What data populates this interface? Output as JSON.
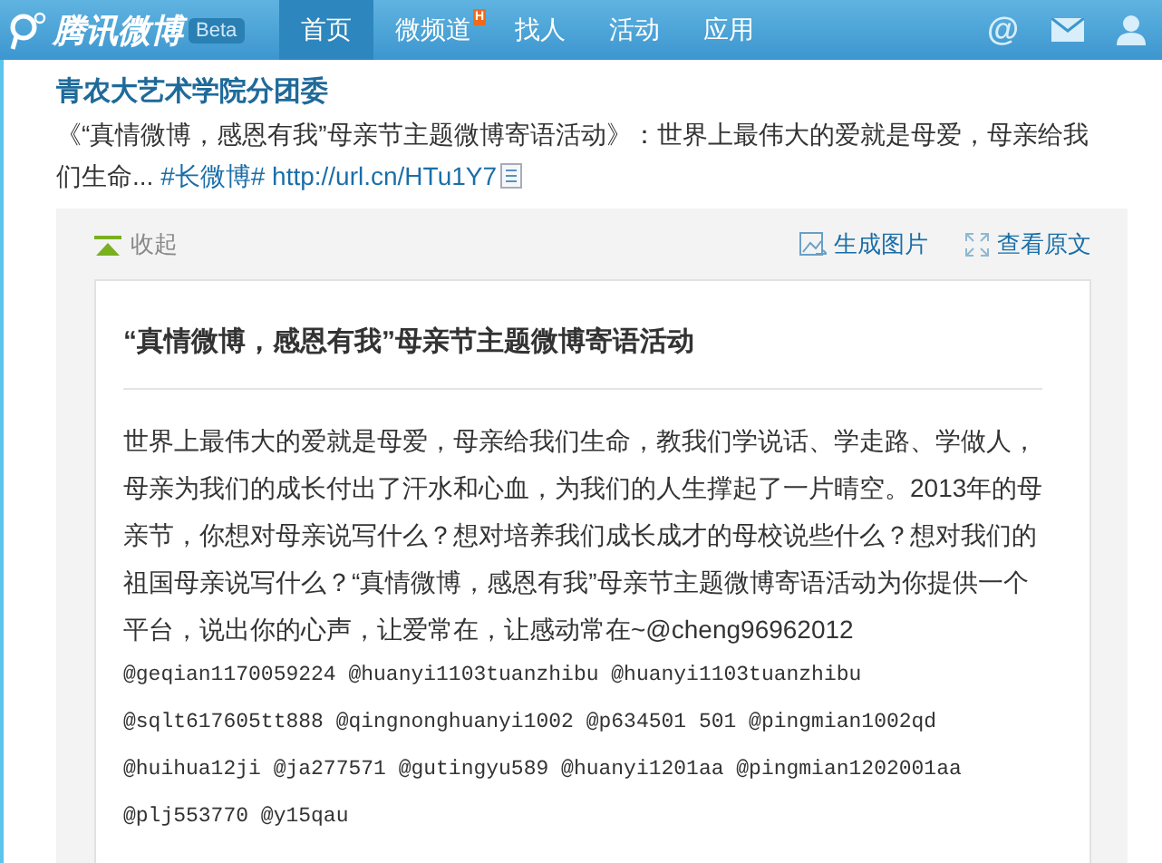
{
  "header": {
    "logo": "腾讯微博",
    "badge": "Beta",
    "tabs": [
      {
        "label": "首页",
        "selected": true
      },
      {
        "label": "微频道",
        "selected": false,
        "badge": "H"
      },
      {
        "label": "找人",
        "selected": false
      },
      {
        "label": "活动",
        "selected": false
      },
      {
        "label": "应用",
        "selected": false
      }
    ],
    "at_symbol": "@"
  },
  "post": {
    "author": "青农大艺术学院分团委",
    "text": "《“真情微博，感恩有我”母亲节主题微博寄语活动》：世界上最伟大的爱就是母爱，母亲给我们生命...",
    "hashtag": "#长微博#",
    "link": "http://url.cn/HTu1Y7"
  },
  "long_post": {
    "collapse": "收起",
    "actions": [
      "生成图片",
      "查看原文"
    ],
    "title": "“真情微博，感恩有我”母亲节主题微博寄语活动",
    "body": "世界上最伟大的爱就是母爱，母亲给我们生命，教我们学说话、学走路、学做人，母亲为我们的成长付出了汗水和心血，为我们的人生撑起了一片晴空。2013年的母亲节，你想对母亲说写什么？想对培养我们成长成才的母校说些什么？想对我们的祖国母亲说写什么？“真情微博，感恩有我”母亲节主题微博寄语活动为你提供一个平台，说出你的心声，让爱常在，让感动常在~@cheng96962012",
    "mention_lines": [
      "@geqian1170059224 @huanyi1103tuanzhibu @huanyi1103tuanzhibu",
      "@sqlt617605tt888 @qingnonghuanyi1002 @p634501 501 @pingmian1002qd",
      "@huihua12ji @ja277571 @gutingyu589 @huanyi1201aa @pingmian1202001aa",
      "@plj553770 @y15qau"
    ]
  }
}
